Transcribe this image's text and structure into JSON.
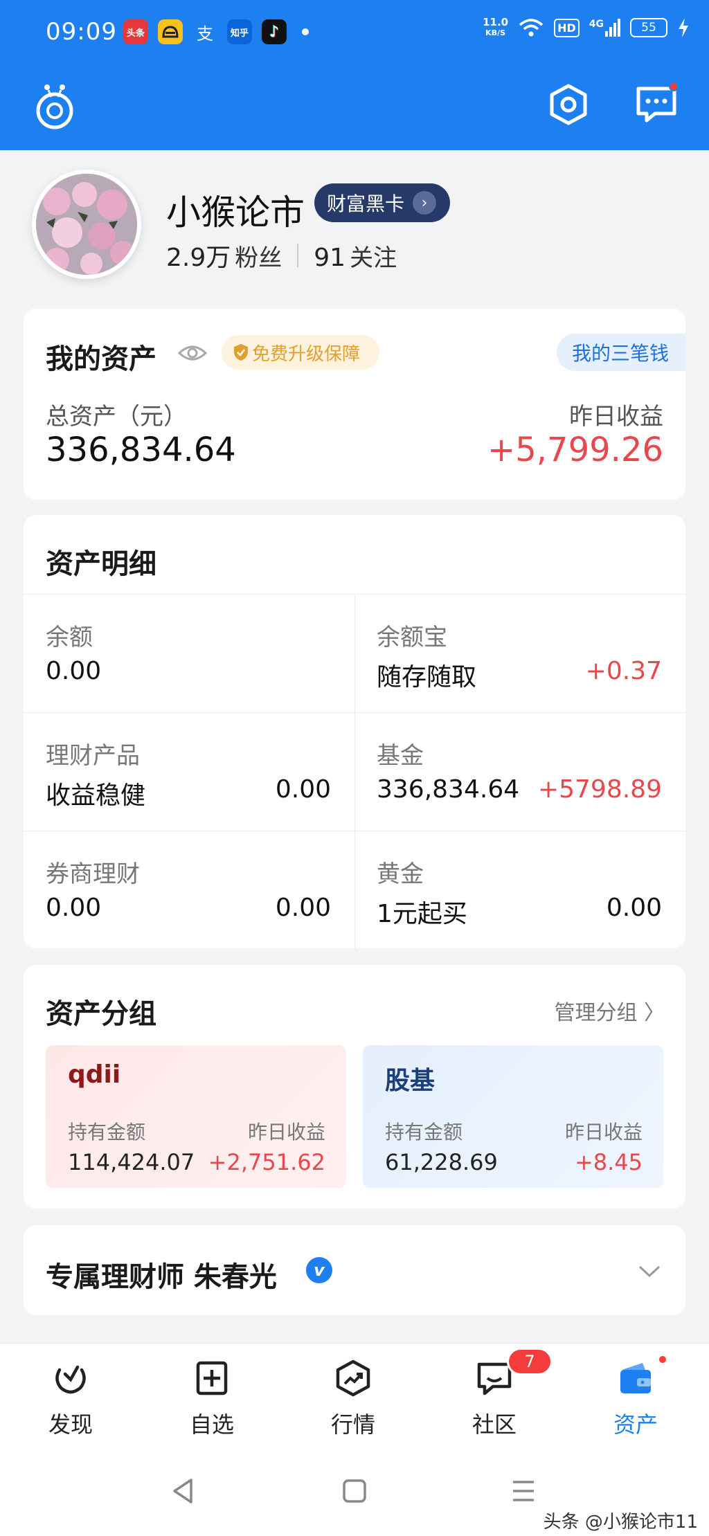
{
  "status_bar": {
    "time": "09:09",
    "apps": [
      {
        "name": "toutiao-app-icon",
        "text": "头条",
        "color": "#e6373c"
      },
      {
        "name": "meituan-app-icon",
        "text": "",
        "color": "#f7c21b"
      },
      {
        "name": "alipay-app-icon",
        "text": "支",
        "color": "#1e7ff0"
      },
      {
        "name": "zhihu-app-icon",
        "text": "知乎",
        "color": "#0a66d8"
      },
      {
        "name": "douyin-app-icon",
        "text": "♪",
        "color": "#111111"
      }
    ],
    "speed_value": "11.0",
    "speed_unit": "KB/S",
    "hd": "HD",
    "signal": "4G",
    "battery": "55"
  },
  "profile": {
    "name": "小猴论市",
    "vip_label": "财富黑卡",
    "followers_count": "2.9万",
    "followers_label": "粉丝",
    "following_count": "91",
    "following_label": "关注"
  },
  "assets": {
    "title": "我的资产",
    "badge": "免费升级保障",
    "three_money": "我的三笔钱",
    "total_label": "总资产（元）",
    "total_value": "336,834.64",
    "yesterday_label": "昨日收益",
    "yesterday_value": "+5,799.26"
  },
  "details": {
    "title": "资产明细",
    "items": [
      {
        "label": "余额",
        "sub": "0.00",
        "amount": "",
        "amount_red": false
      },
      {
        "label": "余额宝",
        "sub": "随存随取",
        "amount": "+0.37",
        "amount_red": true
      },
      {
        "label": "理财产品",
        "sub": "收益稳健",
        "amount": "0.00",
        "amount_red": false
      },
      {
        "label": "基金",
        "sub": "336,834.64",
        "amount": "+5798.89",
        "amount_red": true
      },
      {
        "label": "券商理财",
        "sub": "0.00",
        "amount": "0.00",
        "amount_red": false
      },
      {
        "label": "黄金",
        "sub": "1元起买",
        "amount": "0.00",
        "amount_red": false
      }
    ]
  },
  "groups": {
    "title": "资产分组",
    "manage_label": "管理分组 〉",
    "items": [
      {
        "name": "qdii",
        "hold_label": "持有金额",
        "hold_value": "114,424.07",
        "yest_label": "昨日收益",
        "yest_value": "+2,751.62"
      },
      {
        "name": "股基",
        "hold_label": "持有金额",
        "hold_value": "61,228.69",
        "yest_label": "昨日收益",
        "yest_value": "+8.45"
      }
    ]
  },
  "advisor": {
    "title": "专属理财师 朱春光",
    "verified": "v"
  },
  "nav": {
    "items": [
      {
        "label": "发现",
        "icon": "discover-icon",
        "active": false
      },
      {
        "label": "自选",
        "icon": "watchlist-icon",
        "active": false
      },
      {
        "label": "行情",
        "icon": "market-icon",
        "active": false
      },
      {
        "label": "社区",
        "icon": "community-icon",
        "active": false,
        "badge": "7"
      },
      {
        "label": "资产",
        "icon": "wallet-icon",
        "active": true
      }
    ]
  },
  "watermark": "头条 @小猴论市11",
  "colors": {
    "brand_blue": "#1e7ff0",
    "gain_red": "#e8474c",
    "badge_gold": "#e1a02c",
    "vip_navy": "#263a6a"
  }
}
